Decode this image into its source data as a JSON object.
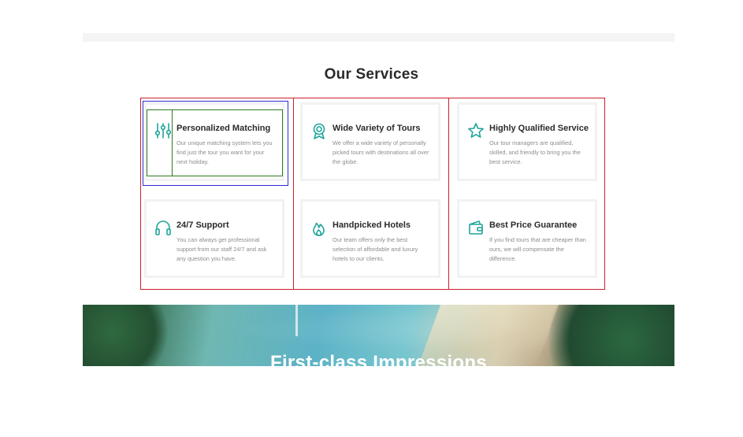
{
  "section": {
    "title": "Our Services"
  },
  "services": [
    {
      "icon": "sliders-icon",
      "title": "Personalized Matching",
      "description": "Our unique matching system lets you find just the tour you want for your next holiday."
    },
    {
      "icon": "award-icon",
      "title": "Wide Variety of Tours",
      "description": "We offer a wide variety of personally picked tours with destinations all over the globe."
    },
    {
      "icon": "star-icon",
      "title": "Highly Qualified Service",
      "description": "Our tour managers are qualified, skilled, and friendly to bring you the best service."
    },
    {
      "icon": "headphones-icon",
      "title": "24/7 Support",
      "description": "You can always get professional support from our staff 24/7 and ask any question you have."
    },
    {
      "icon": "flame-icon",
      "title": "Handpicked Hotels",
      "description": "Our team offers only the best selection of affordable and luxury hotels to our clients."
    },
    {
      "icon": "wallet-icon",
      "title": "Best Price Guarantee",
      "description": "If you find tours that are cheaper than ours, we will compensate the difference."
    }
  ],
  "hero": {
    "title": "First-class Impressions"
  },
  "colors": {
    "accent": "#1fa59b",
    "outline_red": "#cc1f2b",
    "outline_blue": "#2b2bcf",
    "outline_green": "#2f7a1f"
  }
}
